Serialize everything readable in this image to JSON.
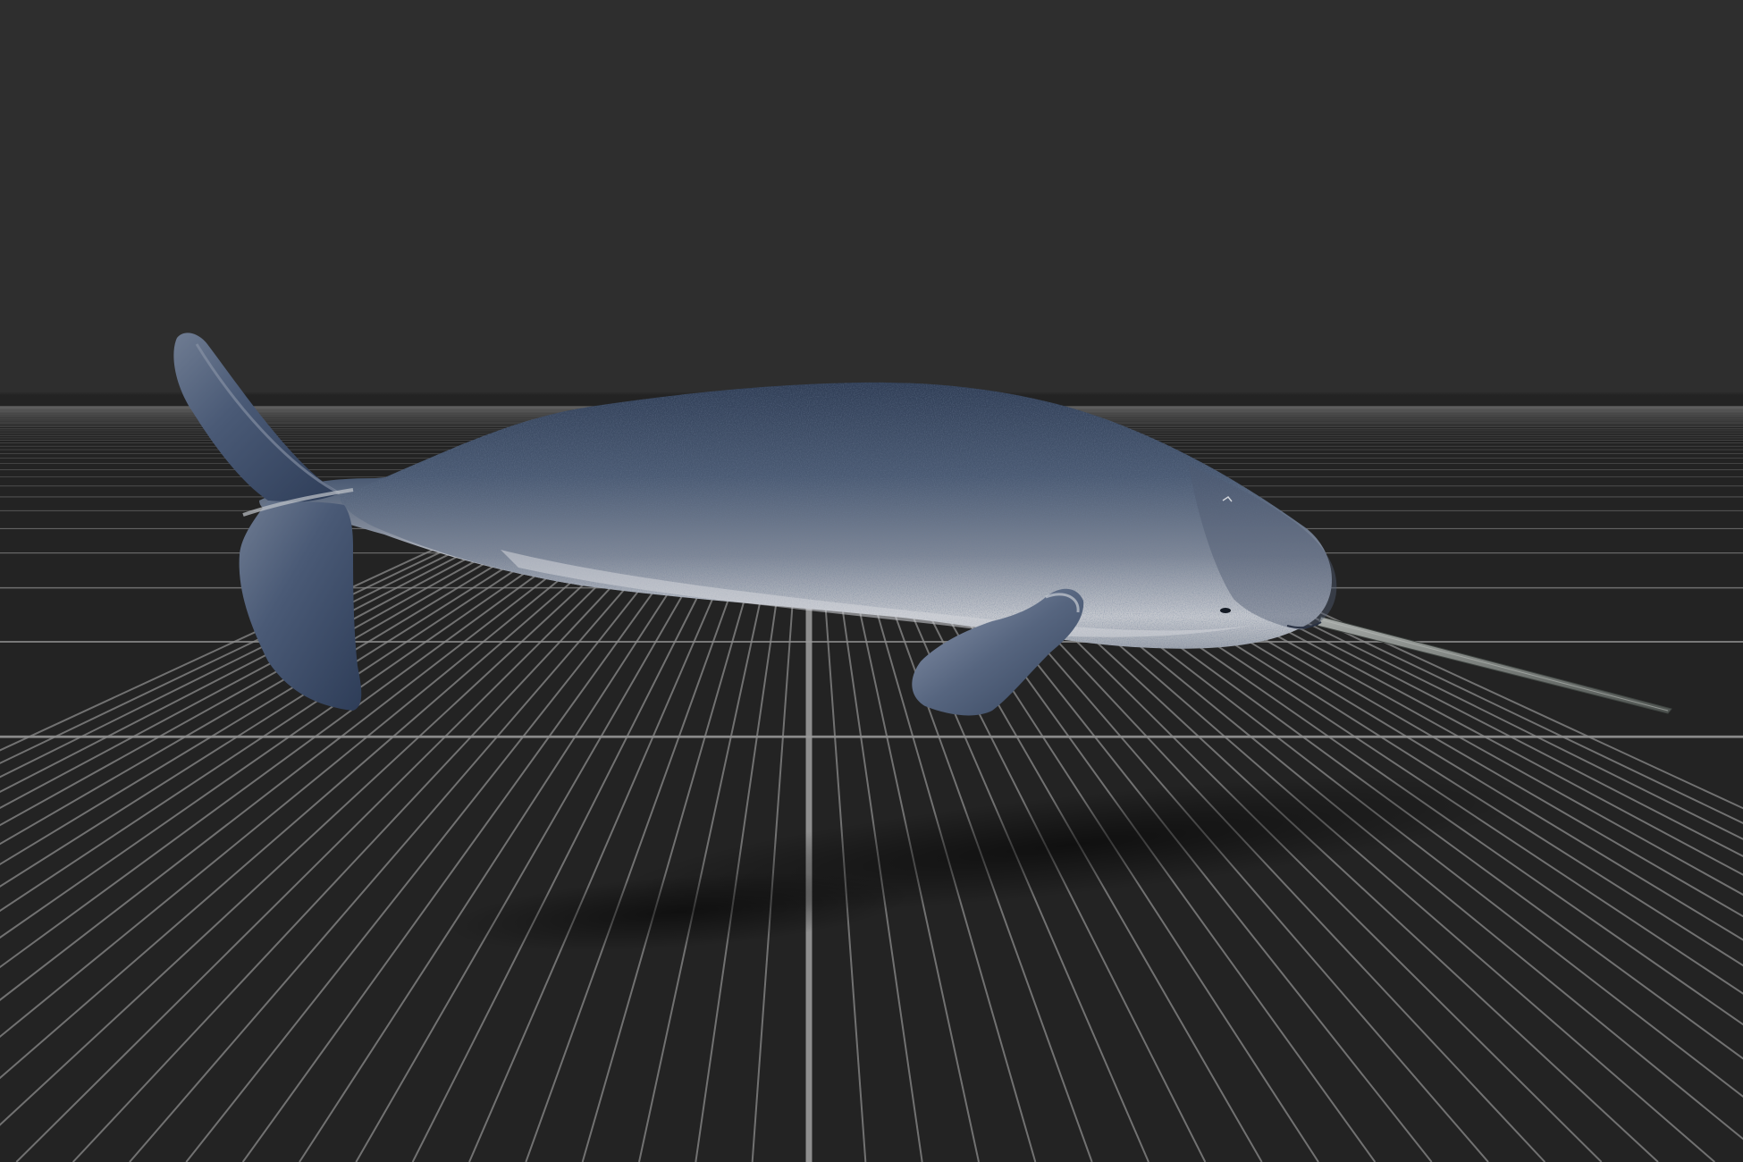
{
  "viewport": {
    "background_color": "#2e2e2e",
    "floor_color": "#222222",
    "grid_color": "#8c8c8c",
    "grid_axis_color": "#9a9a9a"
  },
  "model": {
    "subject": "narwhal",
    "body_color_dark": "#3b4a60",
    "body_color_light": "#c9ccd2",
    "tusk_color": "#8a8e8c"
  }
}
